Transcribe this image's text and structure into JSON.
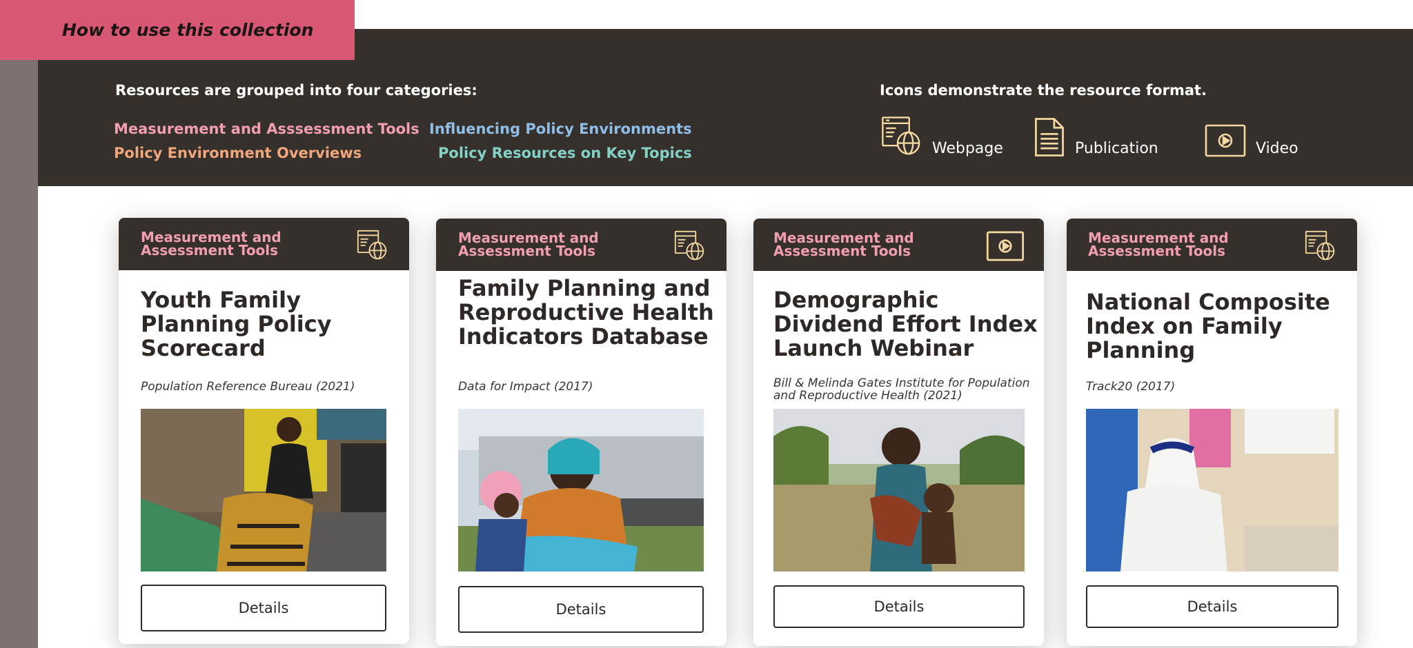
{
  "collection_tag": "How to use this collection",
  "intro": {
    "categories_heading": "Resources are grouped into four categories:",
    "categories": [
      "Measurement and Asssessment Tools",
      "Influencing Policy Environments",
      "Policy Environment Overviews",
      "Policy Resources on Key Topics"
    ],
    "formats_heading": "Icons demonstrate the resource format.",
    "formats": [
      {
        "label": "Webpage",
        "icon": "webpage-icon"
      },
      {
        "label": "Publication",
        "icon": "publication-icon"
      },
      {
        "label": "Video",
        "icon": "video-icon"
      }
    ]
  },
  "colors": {
    "dark_band": "#36302d",
    "tag": "#d85873",
    "category_pink": "#f19fb0",
    "category_blue": "#8fbfe6",
    "category_orange": "#f0a77c",
    "category_teal": "#84d1c6",
    "icon_gold": "#f3d9a1"
  },
  "cards": [
    {
      "category": "Measurement and Assessment Tools",
      "format_icon": "webpage-icon",
      "title": "Youth Family Planning Policy Scorecard",
      "source": "Population Reference Bureau (2021)",
      "photo": "woman-seated-workshop-photo",
      "button": "Details"
    },
    {
      "category": "Measurement and Assessment Tools",
      "format_icon": "webpage-icon",
      "title": "Family Planning and Reproductive Health Indicators Database",
      "source": "Data for Impact (2017)",
      "photo": "mother-carrying-baby-photo",
      "button": "Details"
    },
    {
      "category": "Measurement and Assessment Tools",
      "format_icon": "video-icon",
      "title": "Demographic Dividend Effort Index Launch Webinar",
      "source": "Bill & Melinda Gates Institute for Population and Reproductive Health (2021)",
      "photo": "mother-holding-child-field-photo",
      "button": "Details"
    },
    {
      "category": "Measurement and Assessment Tools",
      "format_icon": "webpage-icon",
      "title": "National Composite Index on Family Planning",
      "source": "Track20 (2017)",
      "photo": "health-worker-clinic-photo",
      "button": "Details"
    }
  ]
}
